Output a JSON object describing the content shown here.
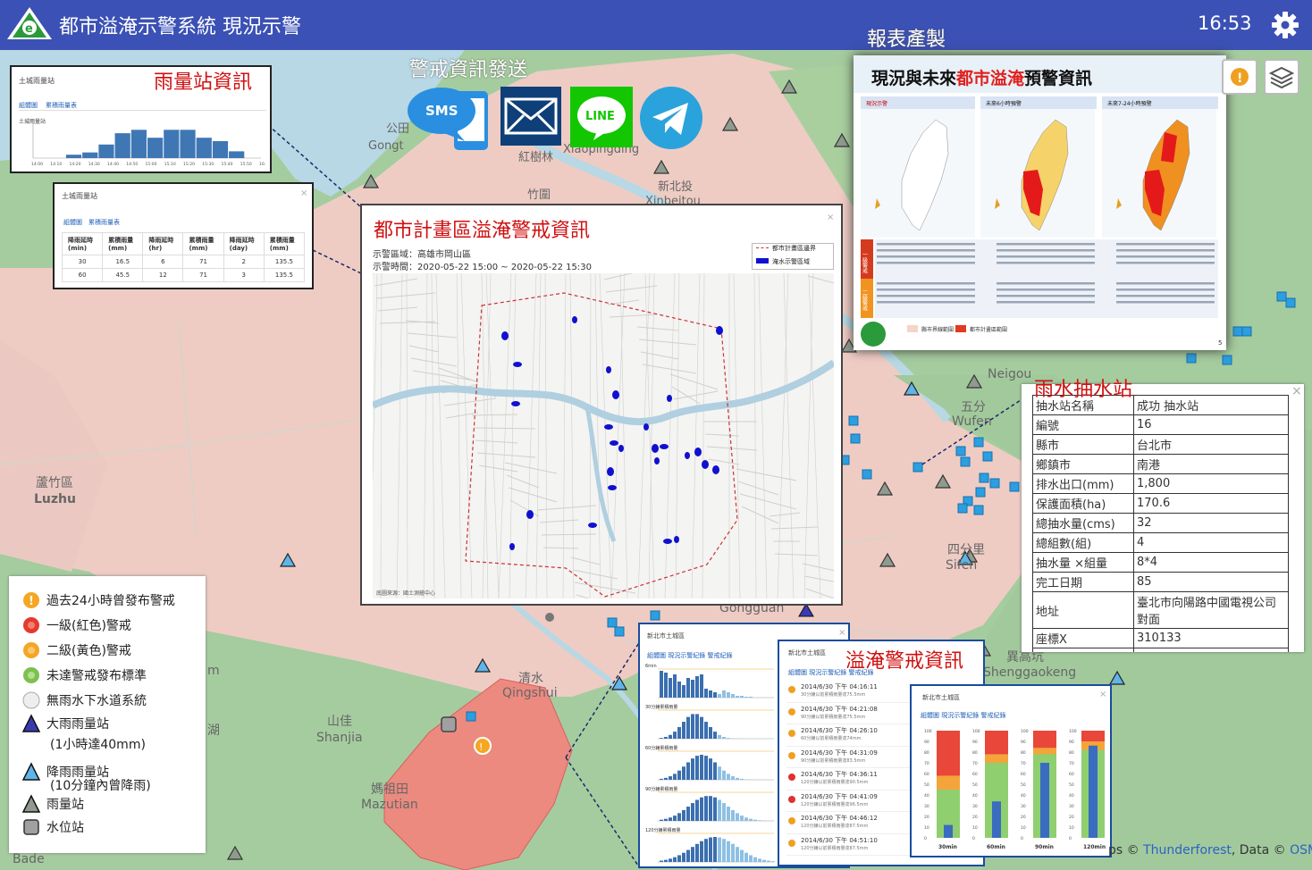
{
  "header": {
    "title": "都市溢淹示警系統 現況示警",
    "clock": "16:53"
  },
  "labels": {
    "rain_station_info": "雨量站資訊",
    "warning_send": "警戒資訊發送",
    "report_make": "報表產製",
    "urban_flood": "都市計畫區溢淹警戒資訊",
    "pump_station": "雨水抽水站",
    "flood_warning": "溢淹警戒資訊"
  },
  "send_icons": {
    "sms": "SMS",
    "line": "LINE"
  },
  "rain_chart_panel": {
    "title": "土城雨量站",
    "tab1": "組體圖",
    "tab2": "累積雨量表",
    "chart_title": "土城雨量站",
    "ticks": [
      "14:00",
      "14:10",
      "14:20",
      "14:30",
      "14:40",
      "14:50",
      "15:00",
      "15:10",
      "15:20",
      "15:30",
      "15:40",
      "15:50",
      "16:00"
    ],
    "values": [
      0,
      0,
      0.3,
      0.5,
      1.2,
      2.2,
      2.5,
      1.8,
      2.5,
      2.5,
      1.8,
      1.5,
      0.6,
      0
    ]
  },
  "rain_table_panel": {
    "title": "土城雨量站",
    "tab1": "組體圖",
    "tab2": "累積雨量表",
    "headers": [
      "降雨延時\n(min)",
      "累積雨量\n(mm)",
      "降雨延時\n(hr)",
      "累積雨量\n(mm)",
      "降雨延時\n(day)",
      "累積雨量\n(mm)"
    ],
    "rows": [
      [
        "30",
        "16.5",
        "6",
        "71",
        "2",
        "135.5"
      ],
      [
        "60",
        "45.5",
        "12",
        "71",
        "3",
        "135.5"
      ]
    ]
  },
  "urban_panel": {
    "area_label": "示警區域：高雄市岡山區",
    "time_label": "示警時間：2020-05-22 15:00 ~ 2020-05-22 15:30",
    "legend1": "都市計畫區邊界",
    "legend2": "淹水示警區域",
    "source": "底圖來源：國土測繪中心"
  },
  "pump": {
    "rows": [
      [
        "抽水站名稱",
        "成功 抽水站"
      ],
      [
        "編號",
        "16"
      ],
      [
        "縣市",
        "台北市"
      ],
      [
        "鄉鎮市",
        "南港"
      ],
      [
        "排水出口(mm)",
        "1,800"
      ],
      [
        "保護面積(ha)",
        "170.6"
      ],
      [
        "總抽水量(cms)",
        "32"
      ],
      [
        "總組數(組)",
        "4"
      ],
      [
        "抽水量 ×組量",
        "8*4"
      ],
      [
        "完工日期",
        "85"
      ],
      [
        "地址",
        "臺北市向陽路中國電視公司對面"
      ],
      [
        "座標X",
        "310133"
      ],
      [
        "座標Y",
        "2772388"
      ]
    ]
  },
  "legend": {
    "items": [
      "過去24小時曾發布警戒",
      "一級(紅色)警戒",
      "二級(黃色)警戒",
      "未達警戒發布標準",
      "無雨水下水道系統",
      "大雨雨量站",
      "降雨雨量站",
      "雨量站",
      "水位站"
    ],
    "sub1": "(1小時達40mm)",
    "sub2": "(10分鐘內曾降雨)"
  },
  "report": {
    "title_pre": "現況與未來",
    "title_red": "都市溢淹",
    "title_post": "預警資訊",
    "col1": "現況示警",
    "col2": "未來6小時預警",
    "col3": "未來7-24小時預警",
    "row1": "一級警戒",
    "row2": "二級警戒",
    "page": "5",
    "legend1": "縣市界線範圍",
    "legend2": "都市計畫區範圍"
  },
  "flood_panel1": {
    "title": "新北市土城區",
    "tabs": "組體圖  現況示警紀錄  警戒紀錄",
    "sub1": "6min",
    "sub2": "30分鐘累積雨量",
    "sub3": "60分鐘累積雨量",
    "sub4": "90分鐘累積雨量",
    "sub5": "120分鐘累積雨量"
  },
  "flood_panel2": {
    "title": "新北市土城區",
    "tabs": "組體圖  現況示警紀錄  警戒紀錄",
    "entries": [
      [
        "2014/6/30 下午 04:16:11",
        "30分鐘以前累積雨量達75.5mm",
        "#f0a020"
      ],
      [
        "2014/6/30 下午 04:21:08",
        "90分鐘以前累積雨量達75.5mm",
        "#f0a020"
      ],
      [
        "2014/6/30 下午 04:26:10",
        "60分鐘以前累積雨量達74mm",
        "#f0a020"
      ],
      [
        "2014/6/30 下午 04:31:09",
        "90分鐘以前累積雨量達83.5mm",
        "#f0a020"
      ],
      [
        "2014/6/30 下午 04:36:11",
        "120分鐘以前累積雨量達90.5mm",
        "#e03030"
      ],
      [
        "2014/6/30 下午 04:41:09",
        "120分鐘以前累積雨量達96.5mm",
        "#e03030"
      ],
      [
        "2014/6/30 下午 04:46:12",
        "120分鐘以前累積雨量達87.5mm",
        "#f0a020"
      ],
      [
        "2014/6/30 下午 04:51:10",
        "120分鐘以前累積雨量達87.5mm",
        "#f0a020"
      ]
    ]
  },
  "flood_panel3": {
    "title": "新北市土城區",
    "tabs": "組體圖  現況示警紀錄  警戒紀錄",
    "categories": [
      "30min",
      "60min",
      "90min",
      "120min"
    ],
    "blue": [
      12,
      34,
      70,
      86
    ],
    "green_top": [
      45,
      70,
      78,
      82
    ],
    "yellow_top": [
      58,
      78,
      84,
      90
    ],
    "yticks": [
      "100",
      "90",
      "80",
      "70",
      "60",
      "50",
      "40",
      "30",
      "20",
      "10",
      "0"
    ]
  },
  "map_labels": {
    "a": "Gongt",
    "b": "紅樹林",
    "c": "Xiaopingding",
    "d": "竹圍",
    "e": "新北投",
    "f": "Xinbeitou",
    "g": "蘆竹區",
    "h": "Luzhu",
    "i": "五分",
    "j": "Wufen",
    "k": "Neigou",
    "l": "四分里",
    "m": "Sifen",
    "n": "山佳",
    "o": "Shanjia",
    "p": "清水",
    "q": "Qingshui",
    "r": "媽祖田",
    "s": "Mazutian",
    "t": "Gongguan",
    "u": "異高坑",
    "v": "Shenggaokeng",
    "w": "Bade",
    "x": "湖",
    "y": "公田",
    "z": "m"
  },
  "attribution": {
    "pre": "ps © ",
    "link1": "Thunderforest",
    "mid": ", Data © ",
    "link2": "OSM"
  }
}
